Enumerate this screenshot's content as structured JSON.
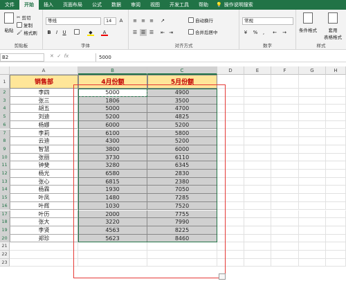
{
  "ribbon_tabs": [
    "文件",
    "开始",
    "插入",
    "页面布局",
    "公式",
    "数据",
    "审阅",
    "视图",
    "开发工具",
    "帮助"
  ],
  "tell_me": "操作说明搜索",
  "clipboard": {
    "paste": "粘贴",
    "cut": "剪切",
    "copy": "复制",
    "format_painter": "格式刷",
    "label": "剪贴板"
  },
  "font": {
    "name": "等线",
    "size": "14",
    "label": "字体",
    "bold": "B",
    "italic": "I",
    "underline": "U",
    "grow": "A",
    "shrink": "A",
    "color_a": "A"
  },
  "alignment": {
    "wrap": "自动换行",
    "merge": "合并后居中",
    "label": "对齐方式"
  },
  "number": {
    "format": "常规",
    "label": "数字",
    "percent": "%",
    "comma": ","
  },
  "styles": {
    "conditional": "条件格式",
    "table": "套用\n表格格式",
    "label": "样式"
  },
  "formula_bar": {
    "name_box": "B2",
    "fx": "fx",
    "value": "5000"
  },
  "columns": [
    "A",
    "B",
    "C",
    "D",
    "E",
    "F",
    "G",
    "H"
  ],
  "rows": [
    "1",
    "2",
    "3",
    "4",
    "5",
    "6",
    "7",
    "8",
    "9",
    "10",
    "11",
    "12",
    "13",
    "14",
    "15",
    "16",
    "17",
    "18",
    "19",
    "20",
    "21",
    "22",
    "23"
  ],
  "table": {
    "headers": [
      "销售部",
      "4月份额",
      "5月份额"
    ],
    "data": [
      [
        "李四",
        "5000",
        "4900"
      ],
      [
        "张三",
        "1806",
        "3500"
      ],
      [
        "胡五",
        "5000",
        "4700"
      ],
      [
        "刘迪",
        "5200",
        "4825"
      ],
      [
        "杨娜",
        "6000",
        "5200"
      ],
      [
        "李莉",
        "6100",
        "5800"
      ],
      [
        "云迪",
        "4300",
        "5200"
      ],
      [
        "智慧",
        "3800",
        "6000"
      ],
      [
        "张丽",
        "3730",
        "6110"
      ],
      [
        "钟斐",
        "3280",
        "6345"
      ],
      [
        "杨光",
        "6580",
        "2830"
      ],
      [
        "张心",
        "6815",
        "2380"
      ],
      [
        "杨霖",
        "1930",
        "7050"
      ],
      [
        "叶凤",
        "1480",
        "7285"
      ],
      [
        "叶辉",
        "1030",
        "7520"
      ],
      [
        "叶历",
        "2000",
        "7755"
      ],
      [
        "张大",
        "3220",
        "7990"
      ],
      [
        "李贤",
        "4563",
        "8225"
      ],
      [
        "郑珍",
        "5623",
        "8460"
      ]
    ]
  }
}
